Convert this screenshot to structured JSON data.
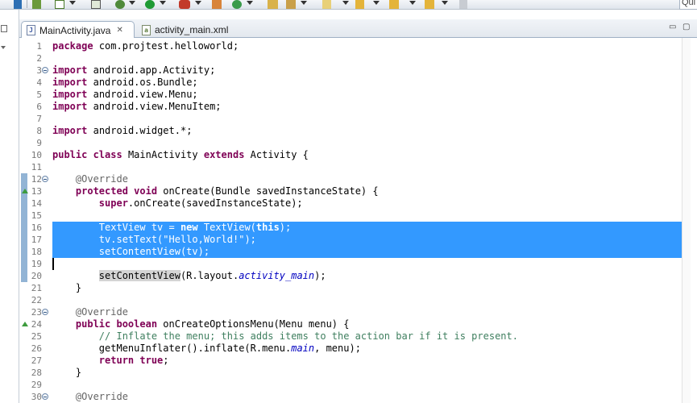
{
  "toolbar": {
    "quick_access_text": "Qui"
  },
  "tabs": [
    {
      "label": "MainActivity.java",
      "icon": "java-file-icon",
      "icon_glyph": "J",
      "active": true
    },
    {
      "label": "activity_main.xml",
      "icon": "xml-file-icon",
      "icon_glyph": "a",
      "active": false
    }
  ],
  "tab_close_glyph": "✕",
  "view_controls": {
    "minimize": "▭",
    "maximize": "▢"
  },
  "editor": {
    "lines": [
      {
        "n": "1",
        "t": [
          [
            "kw",
            "package"
          ],
          [
            "",
            "com.projtest.helloworld;"
          ]
        ]
      },
      {
        "n": "2",
        "t": []
      },
      {
        "n": "3",
        "fold": true,
        "t": [
          [
            "kw",
            "import"
          ],
          [
            "",
            "android.app.Activity;"
          ]
        ]
      },
      {
        "n": "4",
        "t": [
          [
            "kw",
            "import"
          ],
          [
            "",
            "android.os.Bundle;"
          ]
        ]
      },
      {
        "n": "5",
        "t": [
          [
            "kw",
            "import"
          ],
          [
            "",
            "android.view.Menu;"
          ]
        ]
      },
      {
        "n": "6",
        "t": [
          [
            "kw",
            "import"
          ],
          [
            "",
            "android.view.MenuItem;"
          ]
        ]
      },
      {
        "n": "7",
        "t": []
      },
      {
        "n": "8",
        "t": [
          [
            "kw",
            "import"
          ],
          [
            "",
            "android.widget.*;"
          ]
        ]
      },
      {
        "n": "9",
        "t": []
      },
      {
        "n": "10",
        "t": [
          [
            "kw",
            "public class"
          ],
          [
            "",
            "MainActivity "
          ],
          [
            "kw",
            "extends"
          ],
          [
            "",
            " Activity {"
          ]
        ]
      },
      {
        "n": "11",
        "t": []
      },
      {
        "n": "12",
        "fold": true,
        "change": true,
        "t": [
          [
            "",
            "    "
          ],
          [
            "an",
            "@Override"
          ]
        ]
      },
      {
        "n": "13",
        "override": true,
        "change": true,
        "t": [
          [
            "",
            "    "
          ],
          [
            "kw",
            "protected void"
          ],
          [
            "",
            " onCreate(Bundle savedInstanceState) {"
          ]
        ]
      },
      {
        "n": "14",
        "change": true,
        "t": [
          [
            "",
            "        "
          ],
          [
            "kw",
            "super"
          ],
          [
            "",
            ".onCreate(savedInstanceState);"
          ]
        ]
      },
      {
        "n": "15",
        "change": true,
        "t": []
      },
      {
        "n": "16",
        "change": true,
        "selected": true,
        "t": [
          [
            "",
            "        TextView tv = "
          ],
          [
            "kw",
            "new"
          ],
          [
            "",
            " TextView("
          ],
          [
            "kw",
            "this"
          ],
          [
            "",
            ");"
          ]
        ]
      },
      {
        "n": "17",
        "change": true,
        "selected": true,
        "t": [
          [
            "",
            "        tv.setText("
          ],
          [
            "str",
            "\"Hello,World!\""
          ],
          [
            "",
            ");"
          ]
        ]
      },
      {
        "n": "18",
        "change": true,
        "selected": true,
        "t": [
          [
            "",
            "        setContentView(tv);"
          ]
        ]
      },
      {
        "n": "19",
        "change": true,
        "caret": true,
        "t": []
      },
      {
        "n": "20",
        "change": true,
        "t": [
          [
            "",
            "        "
          ],
          [
            "occ",
            "setContentView"
          ],
          [
            "",
            "(R.layout."
          ],
          [
            "fld",
            "activity_main"
          ],
          [
            "",
            ");"
          ]
        ]
      },
      {
        "n": "21",
        "t": [
          [
            "",
            "    }"
          ]
        ]
      },
      {
        "n": "22",
        "t": []
      },
      {
        "n": "23",
        "fold": true,
        "t": [
          [
            "",
            "    "
          ],
          [
            "an",
            "@Override"
          ]
        ]
      },
      {
        "n": "24",
        "override": true,
        "t": [
          [
            "",
            "    "
          ],
          [
            "kw",
            "public boolean"
          ],
          [
            "",
            " onCreateOptionsMenu(Menu menu) {"
          ]
        ]
      },
      {
        "n": "25",
        "t": [
          [
            "",
            "        "
          ],
          [
            "cm",
            "// Inflate the menu; this adds items to the action bar if it is present."
          ]
        ]
      },
      {
        "n": "26",
        "t": [
          [
            "",
            "        getMenuInflater().inflate(R.menu."
          ],
          [
            "fld",
            "main"
          ],
          [
            "",
            ", menu);"
          ]
        ]
      },
      {
        "n": "27",
        "t": [
          [
            "",
            "        "
          ],
          [
            "kw",
            "return true"
          ],
          [
            "",
            ";"
          ]
        ]
      },
      {
        "n": "28",
        "t": [
          [
            "",
            "    }"
          ]
        ]
      },
      {
        "n": "29",
        "t": []
      },
      {
        "n": "30",
        "fold": true,
        "t": [
          [
            "",
            "    "
          ],
          [
            "an",
            "@Override"
          ]
        ]
      }
    ]
  },
  "colors": {
    "keyword": "#7f0055",
    "annotation": "#646464",
    "string": "#2a00ff",
    "comment": "#3f7f5f",
    "field": "#0000c0",
    "selection": "#3399ff"
  }
}
